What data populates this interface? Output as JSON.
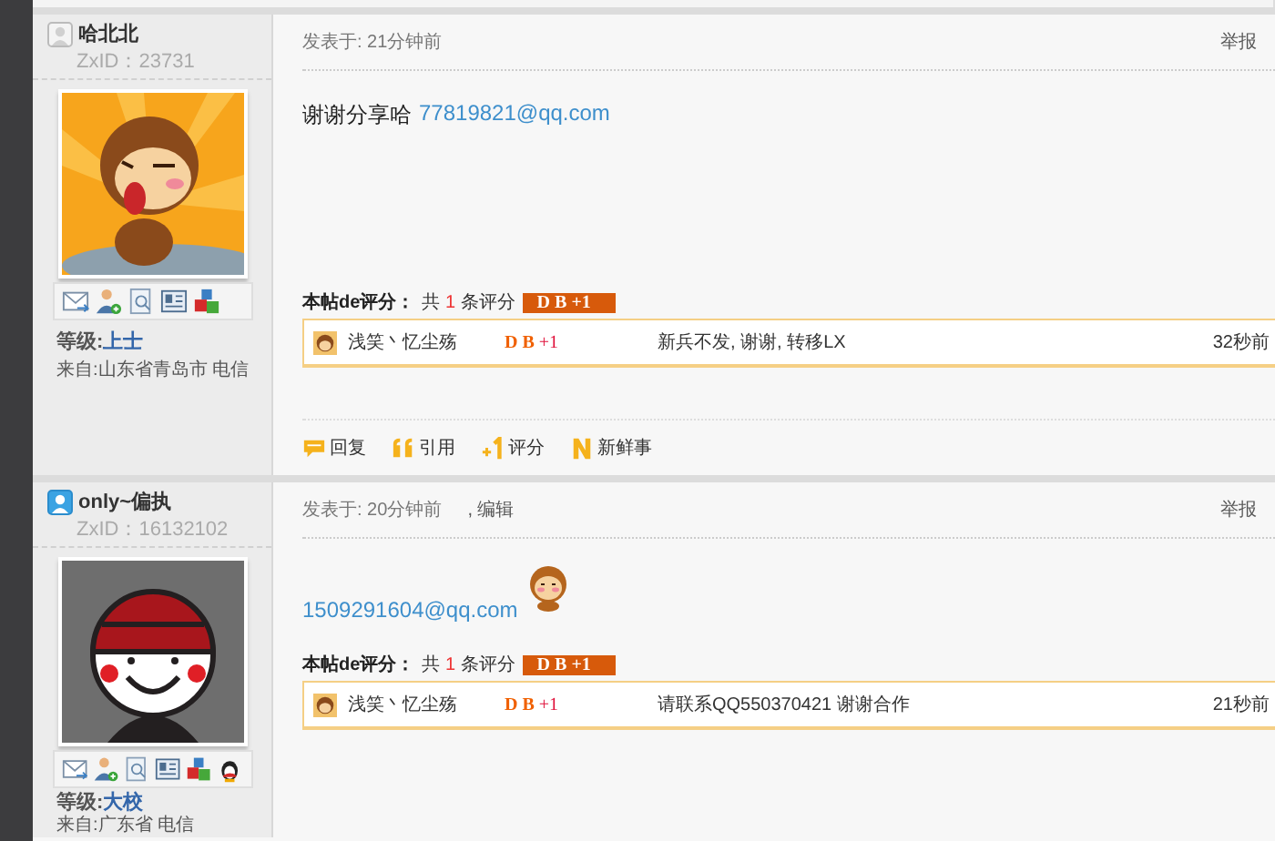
{
  "posts": [
    {
      "author": {
        "name": "哈北北",
        "online": false,
        "zxid": "ZxID：23731",
        "avatar": {
          "kind": "monkey"
        },
        "contact_icons": [
          {
            "kind": "message"
          },
          {
            "kind": "add-friend"
          },
          {
            "kind": "document"
          },
          {
            "kind": "profile-card"
          },
          {
            "kind": "blocks"
          }
        ],
        "level_label": "等级:",
        "level": "上士",
        "from": "来自:山东省青岛市 电信"
      },
      "posted": "发表于: 21分钟前",
      "report": "举报",
      "body": {
        "text": "谢谢分享哈",
        "email": "77819821@qq.com"
      },
      "rating": {
        "label": "本帖de评分：",
        "prefix": "共",
        "count": "1",
        "suffix": "条评分",
        "badge": "D B +1",
        "entries": [
          {
            "rater": "浅笑丶忆尘殇",
            "currency": "D B",
            "amount": "+1",
            "reason": "新兵不发, 谢谢, 转移LX",
            "time": "32秒前"
          }
        ]
      },
      "actions": [
        {
          "kind": "reply",
          "label": "回复"
        },
        {
          "kind": "quote",
          "label": "引用"
        },
        {
          "kind": "rate",
          "label": "评分"
        },
        {
          "kind": "news",
          "label": "新鲜事"
        }
      ]
    },
    {
      "author": {
        "name": "only~偏执",
        "online": true,
        "zxid": "ZxID：16132102",
        "avatar": {
          "kind": "cap-kid"
        },
        "contact_icons": [
          {
            "kind": "message"
          },
          {
            "kind": "add-friend"
          },
          {
            "kind": "document"
          },
          {
            "kind": "profile-card"
          },
          {
            "kind": "blocks"
          },
          {
            "kind": "penguin"
          }
        ],
        "level_label": "等级:",
        "level": "大校",
        "from": "来自:广东省 电信"
      },
      "posted": "发表于: 20分钟前",
      "edit": ", 编辑",
      "report": "举报",
      "body": {
        "email": "1509291604@qq.com",
        "emoticon": true
      },
      "rating": {
        "label": "本帖de评分：",
        "prefix": "共",
        "count": "1",
        "suffix": "条评分",
        "badge": "D B +1",
        "entries": [
          {
            "rater": "浅笑丶忆尘殇",
            "currency": "D B",
            "amount": "+1",
            "reason": "请联系QQ550370421 谢谢合作",
            "time": "21秒前"
          }
        ]
      }
    }
  ]
}
